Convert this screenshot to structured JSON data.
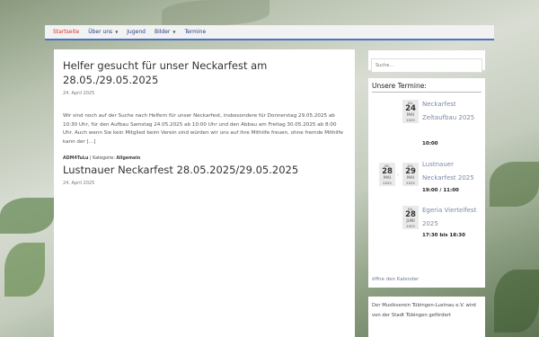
{
  "nav": {
    "items": [
      {
        "label": "Startseite",
        "active": true,
        "dropdown": false
      },
      {
        "label": "Über uns",
        "active": false,
        "dropdown": true
      },
      {
        "label": "Jugend",
        "active": false,
        "dropdown": false
      },
      {
        "label": "Bilder",
        "active": false,
        "dropdown": true
      },
      {
        "label": "Termine",
        "active": false,
        "dropdown": false
      }
    ]
  },
  "posts": [
    {
      "title": "Helfer gesucht für unser Neckarfest am 28.05./29.05.2025",
      "date": "24. April 2025",
      "excerpt": "Wir sind noch auf der Suche nach Helfern für unser Neckarfest, insbesondere für Donnerstag 29.05.2025 ab 10:30 Uhr, für den Aufbau Samstag 24.05.2025 ab 10:00 Uhr und den Abbau am Freitag 30.05.2025 ab 8:00 Uhr. Auch wenn Sie kein Mitglied beim Verein sind würden wir uns auf ihre Mithilfe freuen, ohne fremde Mithilfe kann der […]",
      "author": "ADM4TuLu",
      "category_label": "Kategorie:",
      "category": "Allgemein"
    },
    {
      "title": "Lustnauer Neckarfest 28.05.2025/29.05.2025",
      "date": "24. April 2025"
    }
  ],
  "sidebar": {
    "search_placeholder": "Suche…",
    "termine_title": "Unsere Termine:",
    "events": [
      {
        "dow": "SA.",
        "day": "24",
        "month": "MAI",
        "year": "2025",
        "title": "Neckarfest Zeltaufbau 2025",
        "time": "10:00"
      },
      {
        "start": {
          "dow": "MI.",
          "day": "28",
          "month": "MAI",
          "year": "2025"
        },
        "end": {
          "dow": "DO.",
          "day": "29",
          "month": "MAI",
          "year": "2025"
        },
        "title": "Lustnauer Neckarfest 2025",
        "time": "19:00 / 11:00"
      },
      {
        "dow": "SA.",
        "day": "28",
        "month": "JUNI",
        "year": "2025",
        "title": "Egeria Viertelfest 2025",
        "time": "17:30 bis 18:30"
      }
    ],
    "calendar_link": "öffne den Kalender",
    "foerder_text": "Der Musikverein Tübingen-Lustnau e.V. wird von der Stadt Tübingen gefördert"
  },
  "colors": {
    "nav_active": "#d9322b",
    "nav_link": "#223f8a",
    "nav_border": "#4a73c4"
  }
}
